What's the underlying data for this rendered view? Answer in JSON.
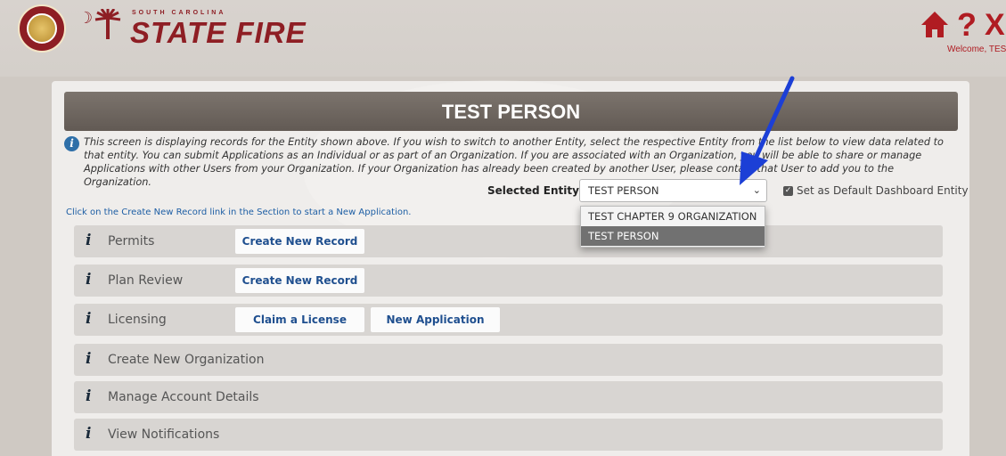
{
  "header": {
    "logo_small": "SOUTH CAROLINA",
    "logo_big": "STATE FIRE",
    "moon_glyph": "☽",
    "palm_glyph": "↑",
    "icons": [
      "home-icon",
      "help-icon",
      "close-icon"
    ],
    "help_glyph": "?",
    "close_glyph": "X",
    "welcome": "Welcome, TES"
  },
  "entity": {
    "title": "TEST PERSON",
    "info_text": "This screen is displaying records for the Entity shown above. If you wish to switch to another Entity, select the respective Entity from the list below to view data related to that entity. You can submit Applications as an Individual or as part of an Organization. If you are associated with an Organization, you will be able to share or manage Applications with other Users from your Organization. If your Organization has already been created by another User, please contact that User to add you to the Organization.",
    "selected_label": "Selected Entity:",
    "selected_value": "TEST PERSON",
    "options": [
      "TEST CHAPTER 9 ORGANIZATION",
      "TEST PERSON"
    ],
    "default_checked": true,
    "default_label": "Set as Default Dashboard Entity"
  },
  "create_hint": "Click on the Create New Record link in the Section to start a New Application.",
  "sections": [
    {
      "label": "Permits",
      "buttons": [
        "Create New Record"
      ]
    },
    {
      "label": "Plan Review",
      "buttons": [
        "Create New Record"
      ]
    },
    {
      "label": "Licensing",
      "buttons": [
        "Claim a License",
        "New Application"
      ]
    },
    {
      "label": "Create New Organization",
      "buttons": []
    },
    {
      "label": "Manage Account Details",
      "buttons": []
    },
    {
      "label": "View Notifications",
      "buttons": []
    }
  ],
  "colors": {
    "brand_red": "#8e1e24",
    "link_blue": "#1f4f8f",
    "annotation_arrow": "#1c3fd6"
  }
}
